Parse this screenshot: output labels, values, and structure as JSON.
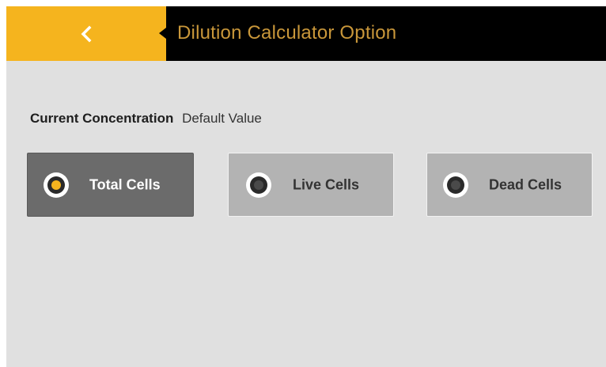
{
  "header": {
    "back_icon": "chevron-left-icon",
    "title": "Dilution Calculator Option"
  },
  "concentration": {
    "label": "Current Concentration",
    "value": "Default Value"
  },
  "options": [
    {
      "label": "Total Cells",
      "selected": true
    },
    {
      "label": "Live Cells",
      "selected": false
    },
    {
      "label": "Dead Cells",
      "selected": false
    }
  ],
  "colors": {
    "accent": "#f5b41e",
    "header_bg": "#000000",
    "title_text": "#c9973a",
    "content_bg": "#e0e0e0",
    "selected_option_bg": "#6b6b6b",
    "unselected_option_bg": "#b3b3b3"
  }
}
